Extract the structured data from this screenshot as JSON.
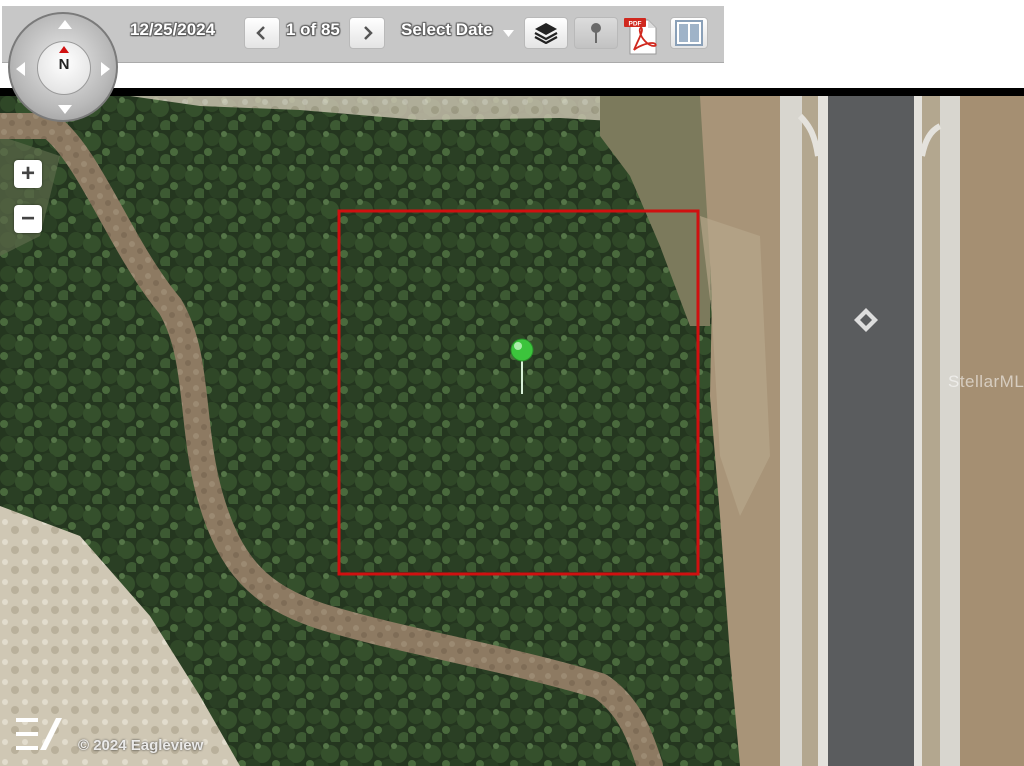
{
  "toolbar": {
    "date": "12/25/2024",
    "page_indicator": "1 of 85",
    "select_date_label": "Select Date"
  },
  "compass": {
    "north_label": "N"
  },
  "zoom": {
    "in_label": "+",
    "out_label": "−"
  },
  "map": {
    "watermark": "StellarMLS",
    "copyright": "© 2024 Eagleview",
    "parcel_outline_color": "#d01010",
    "pin_color": "#3cc43c"
  },
  "icons": {
    "prev": "chevron-left-icon",
    "next": "chevron-right-icon",
    "dropdown": "caret-down-icon",
    "layers": "layers-icon",
    "pin": "pin-icon",
    "pdf": "pdf-icon",
    "split": "split-view-icon"
  }
}
